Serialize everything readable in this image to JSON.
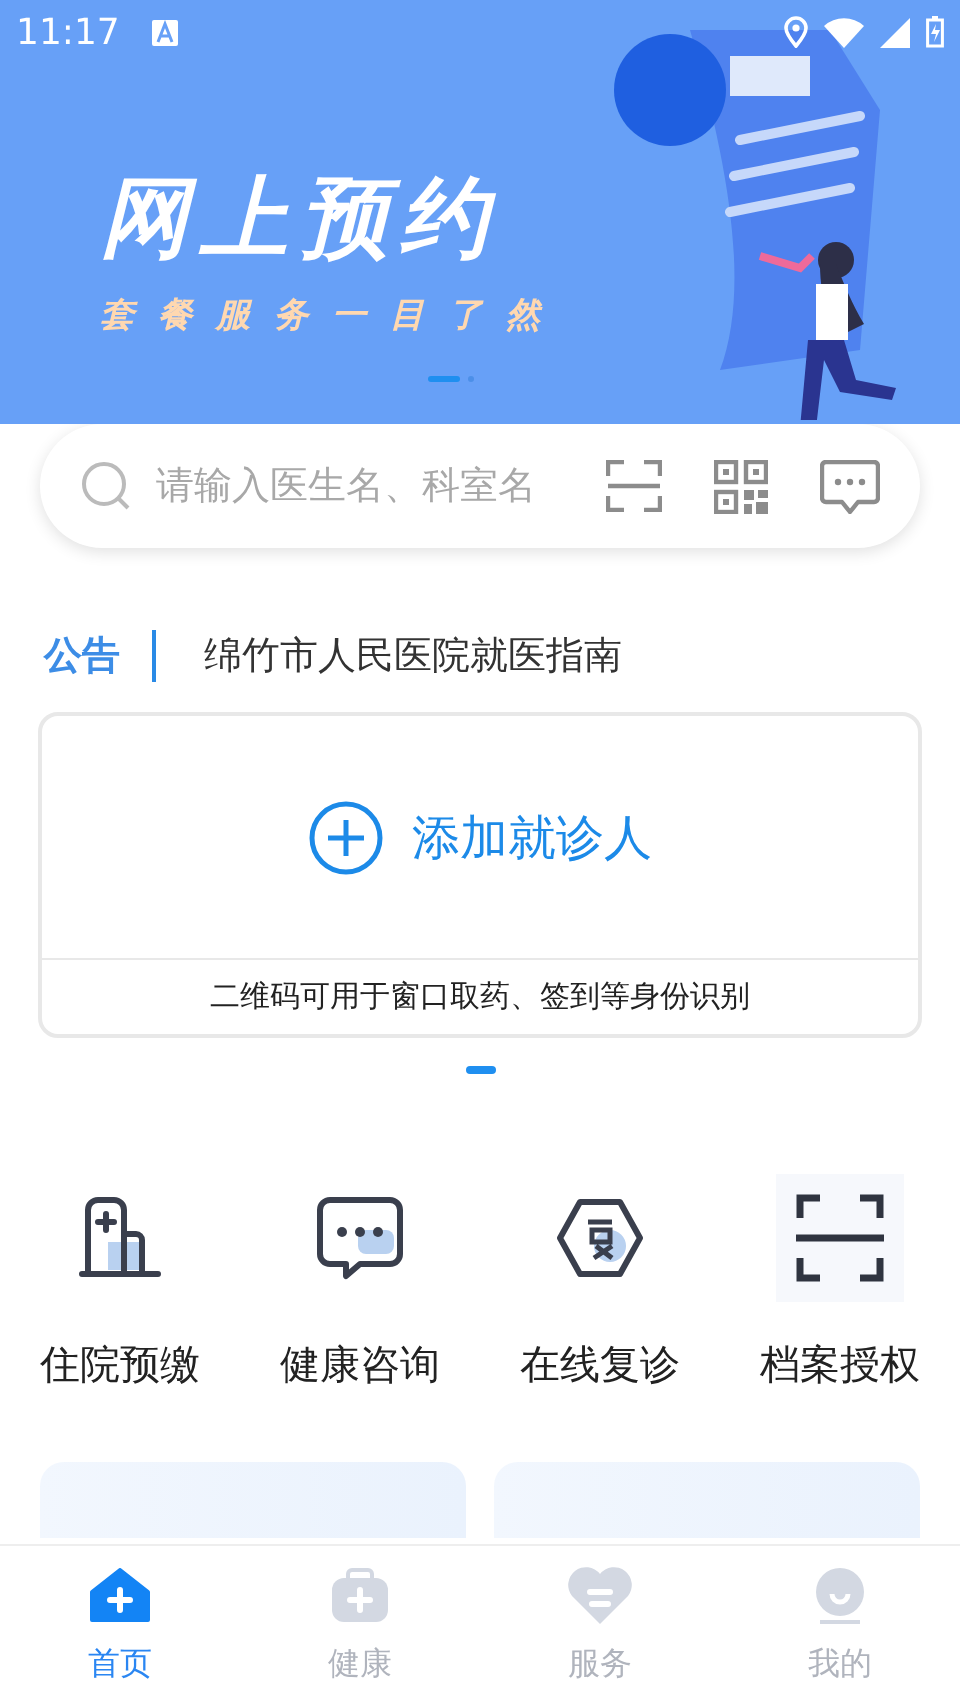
{
  "status_bar": {
    "time": "11:17"
  },
  "banner": {
    "title": "网上预约",
    "subtitle": "套餐服务一目了然",
    "dots": [
      {
        "selected": true
      },
      {
        "selected": false
      }
    ]
  },
  "search": {
    "placeholder": "请输入医生名、科室名"
  },
  "notice": {
    "label": "公告",
    "text": "绵竹市人民医院就医指南"
  },
  "patient_card": {
    "add_label": "添加就诊人",
    "note": "二维码可用于窗口取药、签到等身份识别",
    "dots": [
      {
        "selected": true
      }
    ]
  },
  "shortcuts": [
    {
      "kind": "hospital",
      "label": "住院预缴"
    },
    {
      "kind": "chat",
      "label": "健康咨询"
    },
    {
      "kind": "revisit",
      "label": "在线复诊"
    },
    {
      "kind": "scan",
      "label": "档案授权"
    }
  ],
  "tab_bar": [
    {
      "kind": "home",
      "label": "首页",
      "selected": true
    },
    {
      "kind": "health",
      "label": "健康",
      "selected": false
    },
    {
      "kind": "service",
      "label": "服务",
      "selected": false
    },
    {
      "kind": "mine",
      "label": "我的",
      "selected": false
    }
  ]
}
